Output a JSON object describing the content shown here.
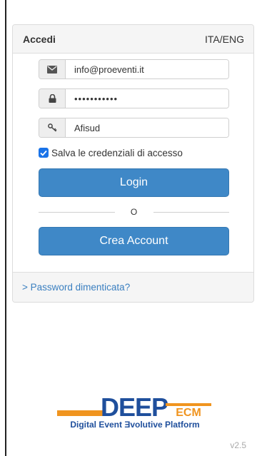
{
  "panel": {
    "title": "Accedi",
    "language_switch": "ITA/ENG"
  },
  "form": {
    "email": {
      "value": "info@proeventi.it",
      "icon": "envelope-icon"
    },
    "password": {
      "value": "•••••••••••",
      "icon": "lock-icon"
    },
    "code": {
      "value": "Afisud",
      "icon": "key-icon"
    },
    "remember": {
      "label": "Salva le credenziali di accesso",
      "checked": true
    },
    "login_label": "Login",
    "separator": "O",
    "create_account_label": "Crea Account"
  },
  "footer": {
    "forgot_password": "> Password dimenticata?"
  },
  "brand": {
    "logo_main": "DEEP",
    "logo_sub": "ECM",
    "tagline": "Digital Event Ǝvolutive Platform",
    "version": "v2.5",
    "colors": {
      "blue": "#1f4f9c",
      "orange": "#f0941f",
      "button": "#3f88c7",
      "link": "#3a7fc0"
    }
  }
}
